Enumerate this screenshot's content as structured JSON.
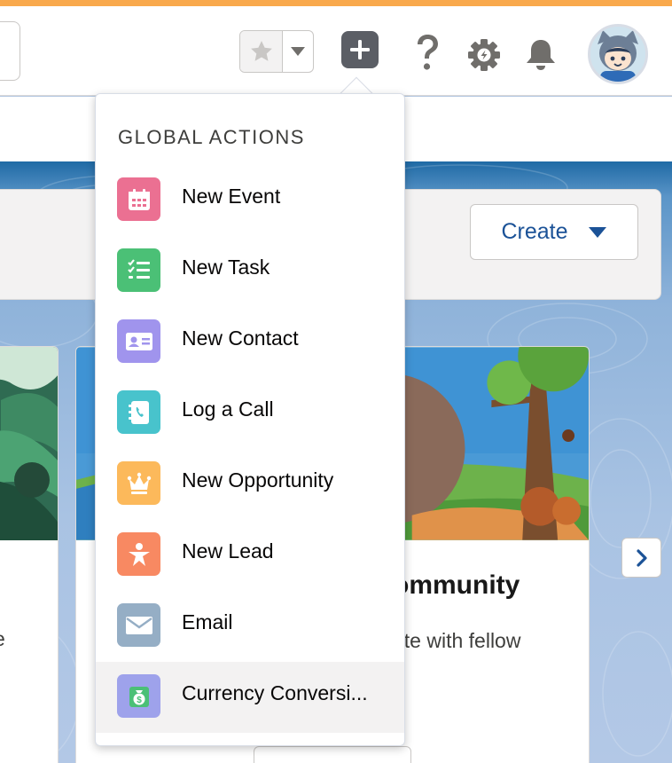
{
  "header": {
    "favorites": {
      "star_icon": "star-icon",
      "dropdown_icon": "chevron-down-icon"
    },
    "global_actions_icon": "plus-icon",
    "help_icon": "question-icon",
    "setup_icon": "gear-icon",
    "notifications_icon": "bell-icon",
    "avatar_icon": "astro-avatar"
  },
  "page": {
    "create_button": {
      "label": "Create",
      "icon": "caret-down-icon"
    },
    "card": {
      "title": "ommunity",
      "description": "nte with fellow"
    },
    "left_card_text": "e",
    "next_icon": "chevron-right-icon"
  },
  "global_actions": {
    "heading": "GLOBAL ACTIONS",
    "items": [
      {
        "label": "New Event",
        "icon": "calendar-icon",
        "color": "#eb7092"
      },
      {
        "label": "New Task",
        "icon": "task-list-icon",
        "color": "#4bc076"
      },
      {
        "label": "New Contact",
        "icon": "contact-card-icon",
        "color": "#a094ed"
      },
      {
        "label": "Log a Call",
        "icon": "phone-icon",
        "color": "#48c3cc"
      },
      {
        "label": "New Opportunity",
        "icon": "crown-icon",
        "color": "#fcb95b"
      },
      {
        "label": "New Lead",
        "icon": "lead-star-icon",
        "color": "#f88962"
      },
      {
        "label": "Email",
        "icon": "envelope-icon",
        "color": "#95aec5"
      },
      {
        "label": "Currency Conversi...",
        "icon": "money-bag-icon",
        "color": "#9ea2eb"
      }
    ]
  },
  "colors": {
    "brand_blue": "#1b5297",
    "header_orange": "#f9a94c",
    "hover_bg": "#f3f2f2"
  }
}
